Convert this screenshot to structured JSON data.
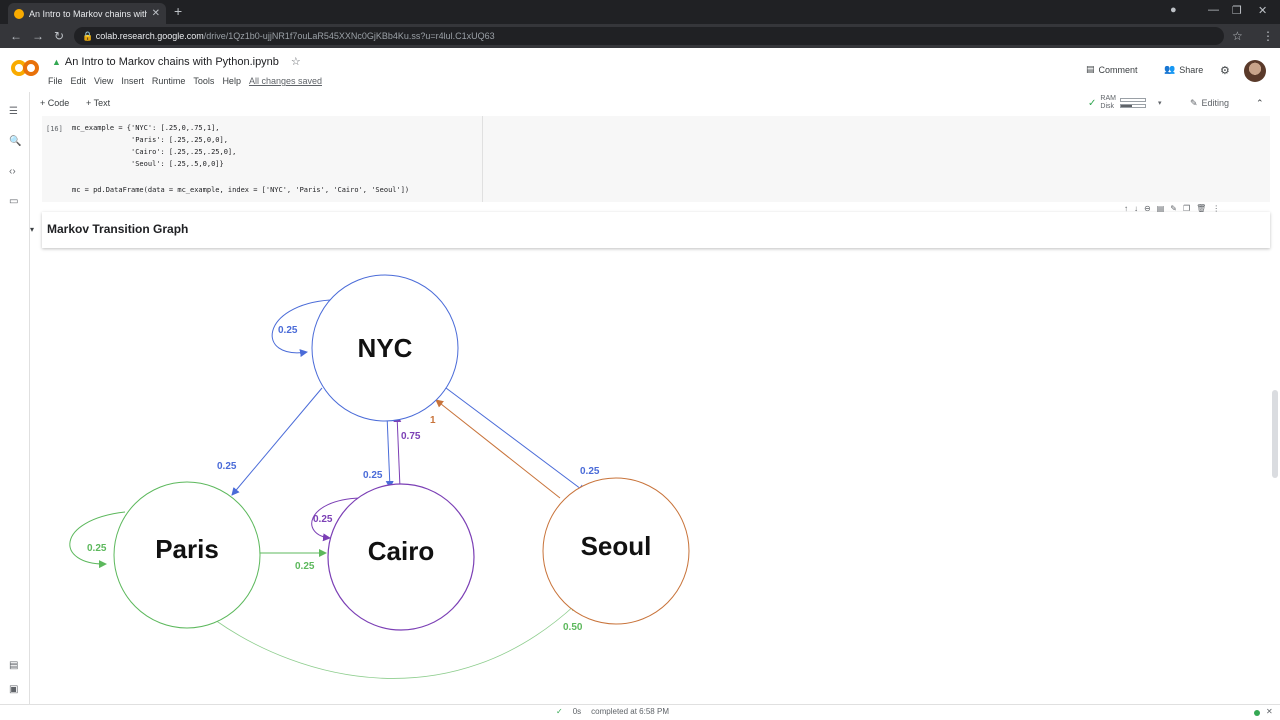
{
  "browser": {
    "tab_title": "An Intro to Markov chains with P",
    "url_host": "colab.research.google.com",
    "url_path": "/drive/1Qz1b0-ujjNR1f7ouLaR545XXNc0GjKBb4Ku.ss?u=r4lul.C1xUQ63"
  },
  "colab": {
    "logo": "CO",
    "notebook_title": "An Intro to Markov chains with Python.ipynb",
    "menu": [
      "File",
      "Edit",
      "View",
      "Insert",
      "Runtime",
      "Tools",
      "Help"
    ],
    "saved_status": "All changes saved",
    "comment_label": "Comment",
    "share_label": "Share",
    "add_code": "+ Code",
    "add_text": "+ Text",
    "ram_label": "RAM",
    "disk_label": "Disk",
    "editing_label": "Editing"
  },
  "code_cell": {
    "exec_count": "[16]",
    "lines": [
      "mc_example = {'NYC': [.25,0,.75,1],",
      "              'Paris': [.25,.25,0,0],",
      "              'Cairo': [.25,.25,.25,0],",
      "              'Seoul': [.25,.5,0,0]}",
      "",
      "mc = pd.DataFrame(data = mc_example, index = ['NYC', 'Paris', 'Cairo', 'Seoul'])"
    ]
  },
  "heading_cell": {
    "text": "Markov Transition Graph"
  },
  "graph": {
    "nodes": [
      {
        "id": "NYC",
        "label": "NYC",
        "color": "#4a6bd8"
      },
      {
        "id": "Paris",
        "label": "Paris",
        "color": "#5cb85c"
      },
      {
        "id": "Cairo",
        "label": "Cairo",
        "color": "#7b3fb5"
      },
      {
        "id": "Seoul",
        "label": "Seoul",
        "color": "#c8733a"
      }
    ],
    "edges": [
      {
        "from": "NYC",
        "to": "NYC",
        "label": "0.25",
        "color": "#4a6bd8"
      },
      {
        "from": "NYC",
        "to": "Paris",
        "label": "0.25",
        "color": "#4a6bd8"
      },
      {
        "from": "NYC",
        "to": "Cairo",
        "label": "0.25",
        "color": "#4a6bd8"
      },
      {
        "from": "NYC",
        "to": "Seoul",
        "label": "0.25",
        "color": "#4a6bd8"
      },
      {
        "from": "Cairo",
        "to": "NYC",
        "label": "0.75",
        "color": "#7b3fb5"
      },
      {
        "from": "Seoul",
        "to": "NYC",
        "label": "1",
        "color": "#c8733a"
      },
      {
        "from": "Paris",
        "to": "Paris",
        "label": "0.25",
        "color": "#5cb85c"
      },
      {
        "from": "Paris",
        "to": "Cairo",
        "label": "0.25",
        "color": "#5cb85c"
      },
      {
        "from": "Paris",
        "to": "Seoul",
        "label": "0.50",
        "color": "#5cb85c"
      },
      {
        "from": "Cairo",
        "to": "Cairo",
        "label": "0.25",
        "color": "#7b3fb5"
      }
    ]
  },
  "status": {
    "check": "✓",
    "duration": "0s",
    "text": "completed at 6:58 PM"
  }
}
